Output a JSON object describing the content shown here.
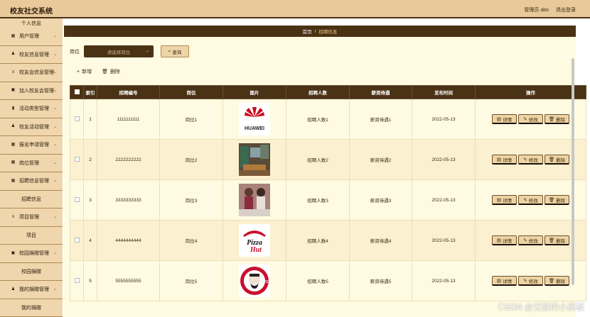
{
  "app": {
    "title": "校友社交系统",
    "admin": "管理员 abo",
    "logout": "退出登录"
  },
  "sidebar": {
    "items": [
      {
        "label": "个人信息",
        "type": "sub"
      },
      {
        "label": "用户管理",
        "type": "item",
        "icon": "grid-icon"
      },
      {
        "label": "校友信息管理",
        "type": "item",
        "icon": "user-icon"
      },
      {
        "label": "校友会信息管理",
        "type": "item",
        "icon": "list-icon"
      },
      {
        "label": "加入校友会管理",
        "type": "item",
        "icon": "box-icon"
      },
      {
        "label": "活动类型管理",
        "type": "item",
        "icon": "bar-icon"
      },
      {
        "label": "校友活动管理",
        "type": "item",
        "icon": "user-icon"
      },
      {
        "label": "报名申请管理",
        "type": "item",
        "icon": "grid-icon"
      },
      {
        "label": "岗位管理",
        "type": "item",
        "icon": "grid-icon"
      },
      {
        "label": "招聘信息管理",
        "type": "item",
        "icon": "grid-icon"
      },
      {
        "label": "招聘信息",
        "type": "sub"
      },
      {
        "label": "项目管理",
        "type": "item",
        "icon": "list-icon"
      },
      {
        "label": "项目",
        "type": "sub"
      },
      {
        "label": "校园捐赠管理",
        "type": "item",
        "icon": "box-icon"
      },
      {
        "label": "校园捐赠",
        "type": "sub"
      },
      {
        "label": "我的捐赠管理",
        "type": "item",
        "icon": "user-icon"
      },
      {
        "label": "我的捐赠",
        "type": "sub"
      }
    ]
  },
  "breadcrumb": {
    "home": "首页",
    "sep": "/",
    "current": "招聘信息"
  },
  "filter": {
    "label": "岗位",
    "placeholder": "请选择岗位",
    "query": "查询"
  },
  "toolbar": {
    "add": "新增",
    "delete": "删除"
  },
  "table": {
    "headers": [
      "索引",
      "招聘编号",
      "岗位",
      "图片",
      "招聘人数",
      "薪资待遇",
      "发布时间",
      "操作"
    ],
    "rows": [
      {
        "index": "1",
        "code": "1111111111",
        "post": "岗位1",
        "image": "huawei-logo",
        "count": "招聘人数1",
        "salary": "薪资待遇1",
        "date": "2022-05-13"
      },
      {
        "index": "2",
        "code": "2222222222",
        "post": "岗位2",
        "image": "office-photo",
        "count": "招聘人数2",
        "salary": "薪资待遇2",
        "date": "2022-05-13"
      },
      {
        "index": "3",
        "code": "3333333333",
        "post": "岗位3",
        "image": "meeting-photo",
        "count": "招聘人数3",
        "salary": "薪资待遇3",
        "date": "2022-05-13"
      },
      {
        "index": "4",
        "code": "4444444444",
        "post": "岗位4",
        "image": "pizzahut-logo",
        "count": "招聘人数4",
        "salary": "薪资待遇4",
        "date": "2022-05-13"
      },
      {
        "index": "5",
        "code": "5555555555",
        "post": "岗位5",
        "image": "kfc-logo",
        "count": "招聘人数5",
        "salary": "薪资待遇5",
        "date": "2022-05-13"
      }
    ],
    "ops": {
      "detail": "详情",
      "edit": "修改",
      "delete": "删除"
    }
  },
  "watermark": "CSDN @无敌的小黑板",
  "colors": {
    "topbar": "#e8c99a",
    "sidebar": "#efd6ad",
    "accent": "#4a3215",
    "content": "#fefbe2",
    "button": "#efd4a3"
  }
}
